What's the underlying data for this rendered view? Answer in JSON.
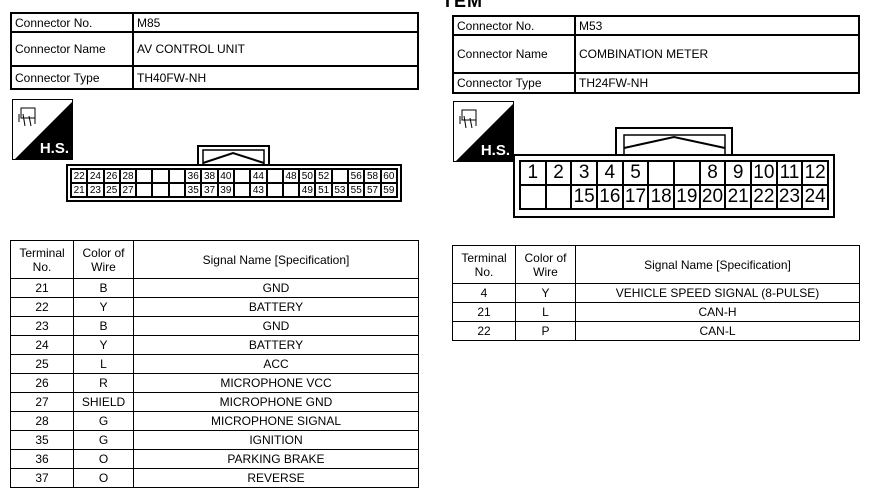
{
  "partial_heading": "TEM",
  "left": {
    "connector_no_label": "Connector No.",
    "connector_no": "M85",
    "connector_name_label": "Connector Name",
    "connector_name": "AV CONTROL UNIT",
    "connector_type_label": "Connector Type",
    "connector_type": "TH40FW-NH",
    "hs_label": "H.S.",
    "pins_top": [
      "22",
      "24",
      "26",
      "28",
      "",
      "",
      "",
      "36",
      "38",
      "40",
      "",
      "44",
      "",
      "48",
      "50",
      "52",
      "",
      "56",
      "58",
      "60"
    ],
    "pins_bottom": [
      "21",
      "23",
      "25",
      "27",
      "",
      "",
      "",
      "35",
      "37",
      "39",
      "",
      "43",
      "",
      "",
      "49",
      "51",
      "53",
      "55",
      "57",
      "59"
    ],
    "table_headers": [
      "Terminal No.",
      "Color of Wire",
      "Signal Name [Specification]"
    ],
    "rows": [
      [
        "21",
        "B",
        "GND"
      ],
      [
        "22",
        "Y",
        "BATTERY"
      ],
      [
        "23",
        "B",
        "GND"
      ],
      [
        "24",
        "Y",
        "BATTERY"
      ],
      [
        "25",
        "L",
        "ACC"
      ],
      [
        "26",
        "R",
        "MICROPHONE VCC"
      ],
      [
        "27",
        "SHIELD",
        "MICROPHONE GND"
      ],
      [
        "28",
        "G",
        "MICROPHONE SIGNAL"
      ],
      [
        "35",
        "G",
        "IGNITION"
      ],
      [
        "36",
        "O",
        "PARKING BRAKE"
      ],
      [
        "37",
        "O",
        "REVERSE"
      ]
    ]
  },
  "right": {
    "connector_no_label": "Connector No.",
    "connector_no": "M53",
    "connector_name_label": "Connector Name",
    "connector_name": "COMBINATION METER",
    "connector_type_label": "Connector Type",
    "connector_type": "TH24FW-NH",
    "hs_label": "H.S.",
    "pins_top": [
      "1",
      "2",
      "3",
      "4",
      "5",
      "",
      "",
      "8",
      "9",
      "10",
      "11",
      "12"
    ],
    "pins_bottom": [
      "",
      "",
      "15",
      "16",
      "17",
      "18",
      "19",
      "20",
      "21",
      "22",
      "23",
      "24"
    ],
    "table_headers": [
      "Terminal No.",
      "Color of Wire",
      "Signal Name [Specification]"
    ],
    "rows": [
      [
        "4",
        "Y",
        "VEHICLE SPEED SIGNAL (8-PULSE)"
      ],
      [
        "21",
        "L",
        "CAN-H"
      ],
      [
        "22",
        "P",
        "CAN-L"
      ]
    ]
  }
}
